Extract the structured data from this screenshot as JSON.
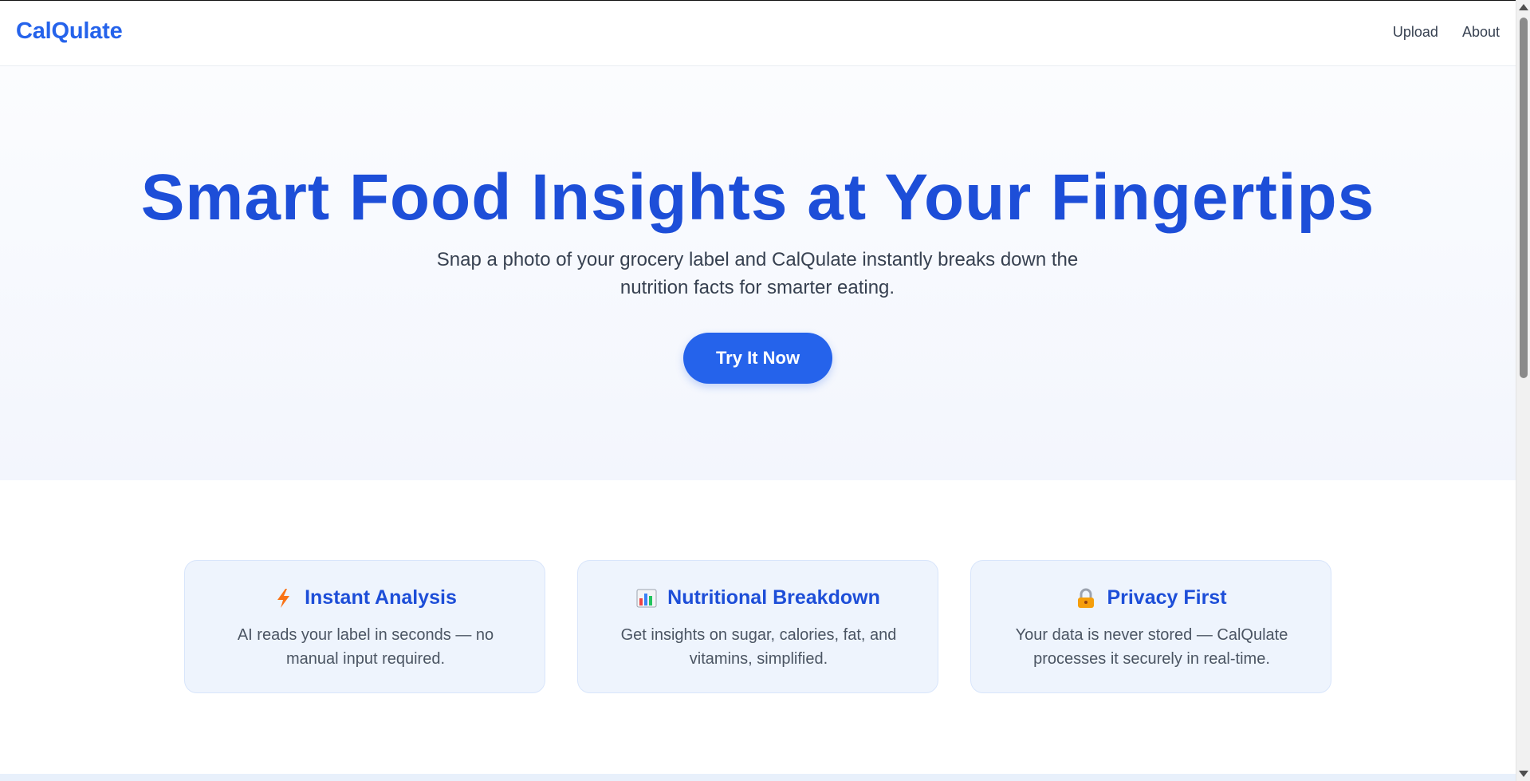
{
  "header": {
    "brand": "CalQulate",
    "nav": [
      {
        "label": "Upload"
      },
      {
        "label": "About"
      }
    ]
  },
  "hero": {
    "title": "Smart Food Insights at Your Fingertips",
    "subtitle": "Snap a photo of your grocery label and CalQulate instantly breaks down the nutrition facts for smarter eating.",
    "cta_label": "Try It Now"
  },
  "features": [
    {
      "icon": "lightning-icon",
      "title": "Instant Analysis",
      "description": "AI reads your label in seconds — no manual input required."
    },
    {
      "icon": "bar-chart-icon",
      "title": "Nutritional Breakdown",
      "description": "Get insights on sugar, calories, fat, and vitamins, simplified."
    },
    {
      "icon": "lock-icon",
      "title": "Privacy First",
      "description": "Your data is never stored — CalQulate processes it securely in real-time."
    }
  ],
  "colors": {
    "accent": "#2563eb",
    "title": "#1d4ed8",
    "card_bg": "#eef4fd",
    "card_border": "#d8e5fb"
  }
}
